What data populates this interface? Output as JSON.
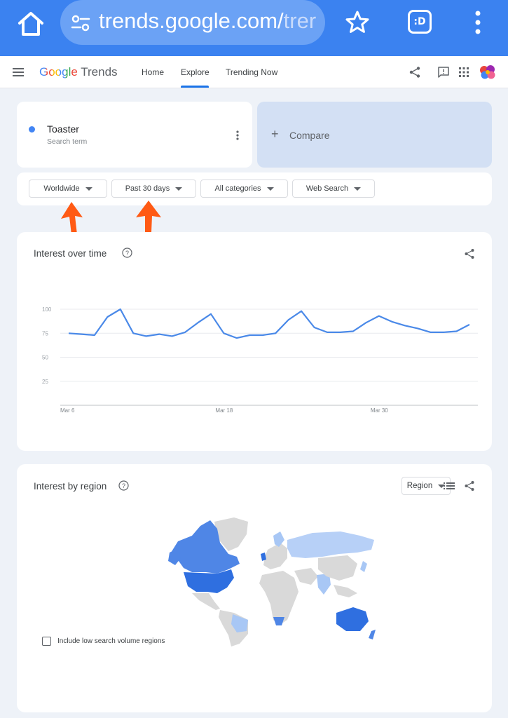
{
  "browser": {
    "url_main": "trends.google.com/",
    "url_faded": "trer",
    "tab_badge": ":D"
  },
  "header": {
    "logo_google": "Google",
    "logo_trends": "Trends",
    "nav": [
      {
        "label": "Home"
      },
      {
        "label": "Explore",
        "active": true
      },
      {
        "label": "Trending Now"
      }
    ]
  },
  "search_term": {
    "name": "Toaster",
    "subtitle": "Search term",
    "color": "#4285f4"
  },
  "compare": {
    "plus": "+",
    "label": "Compare"
  },
  "filters": [
    {
      "label": "Worldwide"
    },
    {
      "label": "Past 30 days"
    },
    {
      "label": "All categories"
    },
    {
      "label": "Web Search"
    }
  ],
  "interest_over_time": {
    "title": "Interest over time"
  },
  "chart_data": {
    "type": "line",
    "title": "Interest over time",
    "xlabel": "",
    "ylabel": "",
    "ylim": [
      0,
      100
    ],
    "yticks": [
      "100",
      "75",
      "50",
      "25"
    ],
    "xticks": [
      "Mar 6",
      "Mar 18",
      "Mar 30"
    ],
    "grid": true,
    "series": [
      {
        "color": "#4a89e8",
        "values": [
          75,
          74,
          73,
          92,
          100,
          75,
          72,
          74,
          72,
          76,
          86,
          95,
          75,
          70,
          73,
          73,
          75,
          89,
          98,
          81,
          76,
          76,
          77,
          86,
          93,
          87,
          83,
          80,
          76,
          76,
          77,
          84
        ]
      }
    ]
  },
  "interest_by_region": {
    "title": "Interest by region",
    "region_select": "Region",
    "checkbox_label": "Include low search volume regions"
  }
}
